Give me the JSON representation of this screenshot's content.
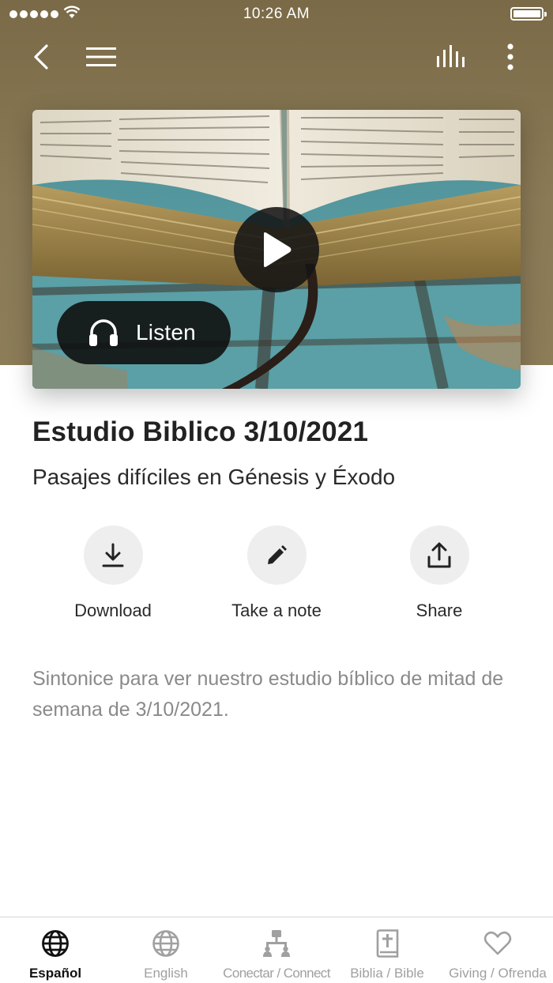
{
  "status_bar": {
    "time": "10:26 AM"
  },
  "nav": {
    "back_icon": "chevron-left-icon",
    "menu_icon": "hamburger-icon",
    "audio_icon": "audio-bars-icon",
    "more_icon": "more-vertical-icon"
  },
  "hero": {
    "play_icon": "play-icon",
    "listen_label": "Listen"
  },
  "content": {
    "title": "Estudio Biblico 3/10/2021",
    "subtitle": "Pasajes difíciles en Génesis y Éxodo",
    "description": "Sintonice para ver nuestro estudio bíblico de mitad de semana de 3/10/2021."
  },
  "actions": [
    {
      "label": "Download",
      "icon": "download-icon"
    },
    {
      "label": "Take a note",
      "icon": "pencil-icon"
    },
    {
      "label": "Share",
      "icon": "share-icon"
    }
  ],
  "tabs": [
    {
      "label": "Español",
      "icon": "globe-icon",
      "active": true
    },
    {
      "label": "English",
      "icon": "globe-icon",
      "active": false
    },
    {
      "label": "Conectar / Connect",
      "icon": "network-icon",
      "active": false
    },
    {
      "label": "Biblia / Bible",
      "icon": "bible-icon",
      "active": false
    },
    {
      "label": "Giving / Ofrenda",
      "icon": "heart-icon",
      "active": false
    }
  ],
  "colors": {
    "header": "#8a7a56",
    "tab_active": "#111111",
    "tab_inactive": "#a0a0a0",
    "action_circle": "#eeeeef"
  }
}
